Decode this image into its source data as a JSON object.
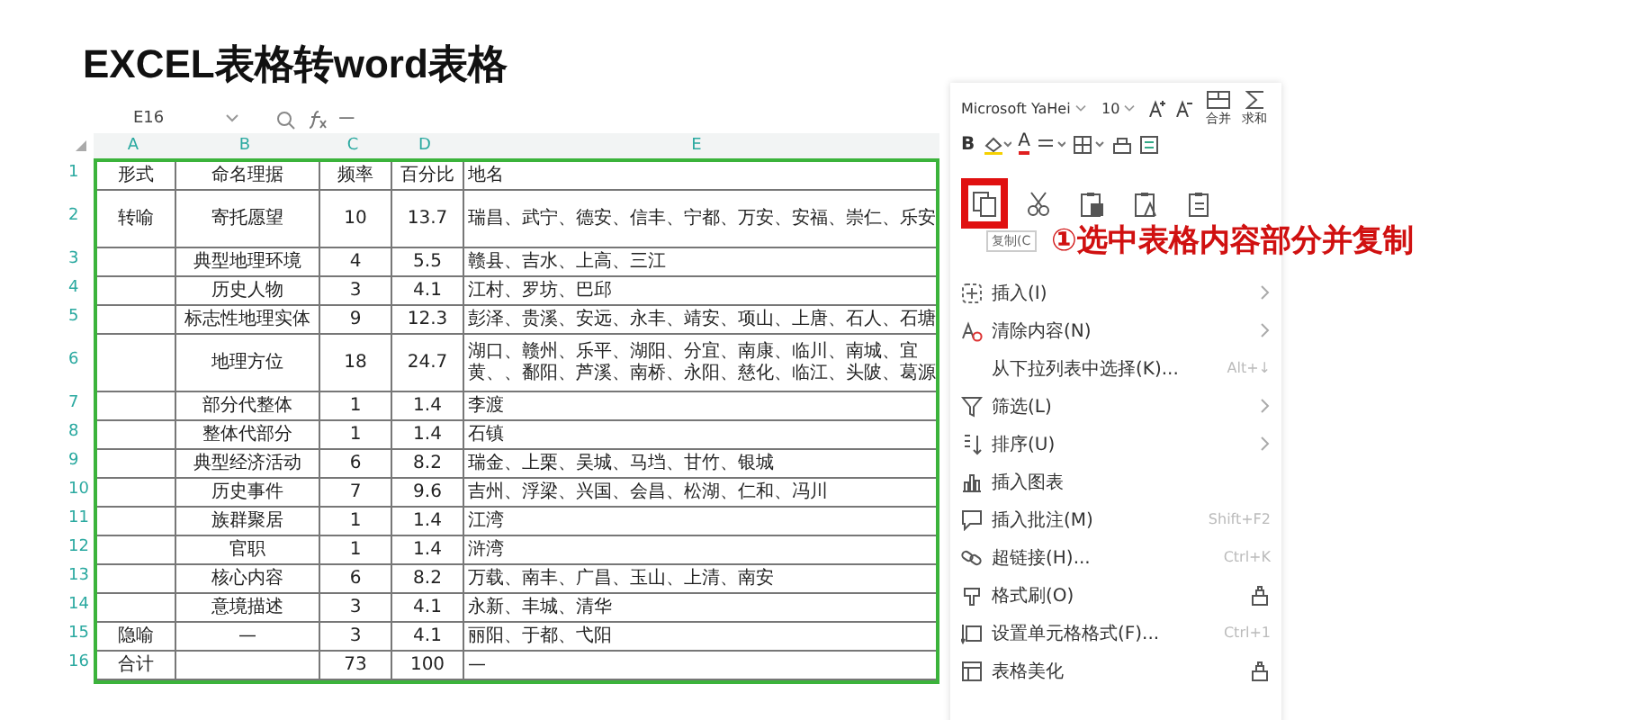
{
  "title": "EXCEL表格转word表格",
  "formula_bar": {
    "cell_ref": "E16",
    "formula": "—"
  },
  "columns": [
    "A",
    "B",
    "C",
    "D",
    "E"
  ],
  "rows": [
    {
      "number": "1",
      "tall": false,
      "cells": [
        "形式",
        "命名理据",
        "频率",
        "百分比",
        "地名"
      ]
    },
    {
      "number": "2",
      "tall": true,
      "cells": [
        "转喻",
        "寄托愿望",
        "10",
        "13.7",
        "瑞昌、武宁、德安、信丰、宁都、万安、安福、崇仁、乐安"
      ]
    },
    {
      "number": "3",
      "tall": false,
      "cells": [
        null,
        "典型地理环境",
        "4",
        "5.5",
        "赣县、吉水、上高、三江"
      ]
    },
    {
      "number": "4",
      "tall": false,
      "cells": [
        null,
        "历史人物",
        "3",
        "4.1",
        "江村、罗坊、巴邱"
      ]
    },
    {
      "number": "5",
      "tall": false,
      "cells": [
        null,
        "标志性地理实体",
        "9",
        "12.3",
        "彭泽、贵溪、安远、永丰、靖安、项山、上唐、石人、石塘"
      ]
    },
    {
      "number": "6",
      "tall": true,
      "cells": [
        null,
        "地理方位",
        "18",
        "24.7",
        "湖口、赣州、乐平、湖阳、分宜、南康、临川、南城、宜黄、、鄱阳、芦溪、南桥、永阳、慈化、临江、头陂、葛源"
      ]
    },
    {
      "number": "7",
      "tall": false,
      "cells": [
        null,
        "部分代整体",
        "1",
        "1.4",
        "李渡"
      ]
    },
    {
      "number": "8",
      "tall": false,
      "cells": [
        null,
        "整体代部分",
        "1",
        "1.4",
        "石镇"
      ]
    },
    {
      "number": "9",
      "tall": false,
      "cells": [
        null,
        "典型经济活动",
        "6",
        "8.2",
        "瑞金、上栗、吴城、马垱、甘竹、银城"
      ]
    },
    {
      "number": "10",
      "tall": false,
      "cells": [
        null,
        "历史事件",
        "7",
        "9.6",
        "吉州、浮梁、兴国、会昌、松湖、仁和、冯川"
      ]
    },
    {
      "number": "11",
      "tall": false,
      "cells": [
        null,
        "族群聚居",
        "1",
        "1.4",
        "江湾"
      ]
    },
    {
      "number": "12",
      "tall": false,
      "cells": [
        null,
        "官职",
        "1",
        "1.4",
        "浒湾"
      ]
    },
    {
      "number": "13",
      "tall": false,
      "cells": [
        null,
        "核心内容",
        "6",
        "8.2",
        "万载、南丰、广昌、玉山、上清、南安"
      ]
    },
    {
      "number": "14",
      "tall": false,
      "cells": [
        null,
        "意境描述",
        "3",
        "4.1",
        "永新、丰城、清华"
      ]
    },
    {
      "number": "15",
      "tall": false,
      "cells": [
        "隐喻",
        "—",
        "3",
        "4.1",
        "丽阳、于都、弋阳"
      ]
    },
    {
      "number": "16",
      "tall": false,
      "cells": [
        "合计",
        null,
        "73",
        "100",
        "—"
      ]
    }
  ],
  "toolbar": {
    "font": "Microsoft YaHei",
    "size": "10",
    "merge": "合并",
    "sum": "求和",
    "bold": "B",
    "font_color": "A"
  },
  "clipboard": [
    {
      "kind": "copy",
      "highlighted": true
    },
    {
      "kind": "cut",
      "highlighted": false
    },
    {
      "kind": "paste",
      "highlighted": false
    },
    {
      "kind": "paste_text",
      "highlighted": false
    },
    {
      "kind": "paste_special",
      "highlighted": false
    }
  ],
  "tooltip": "复制(C",
  "annotation": "①选中表格内容部分并复制",
  "menu": [
    {
      "kind": "insert",
      "label": "插入(I)",
      "submenu": true,
      "trailing_icon": false
    },
    {
      "kind": "clear",
      "label": "清除内容(N)",
      "submenu": true,
      "trailing_icon": false
    },
    {
      "kind": "plain",
      "label": "从下拉列表中选择(K)...",
      "shortcut": "Alt+↓",
      "submenu": false,
      "trailing_icon": false
    },
    {
      "kind": "filter",
      "label": "筛选(L)",
      "submenu": true,
      "trailing_icon": false
    },
    {
      "kind": "sort",
      "label": "排序(U)",
      "submenu": true,
      "trailing_icon": false
    },
    {
      "kind": "chart",
      "label": "插入图表",
      "submenu": false,
      "trailing_icon": false
    },
    {
      "kind": "comment",
      "label": "插入批注(M)",
      "shortcut": "Shift+F2",
      "submenu": false,
      "trailing_icon": false
    },
    {
      "kind": "link",
      "label": "超链接(H)...",
      "shortcut": "Ctrl+K",
      "submenu": false,
      "trailing_icon": false
    },
    {
      "kind": "brush",
      "label": "格式刷(O)",
      "submenu": false,
      "trailing_icon": true
    },
    {
      "kind": "format",
      "label": "设置单元格格式(F)...",
      "shortcut": "Ctrl+1",
      "submenu": false,
      "trailing_icon": false
    },
    {
      "kind": "table",
      "label": "表格美化",
      "submenu": false,
      "trailing_icon": true
    }
  ]
}
